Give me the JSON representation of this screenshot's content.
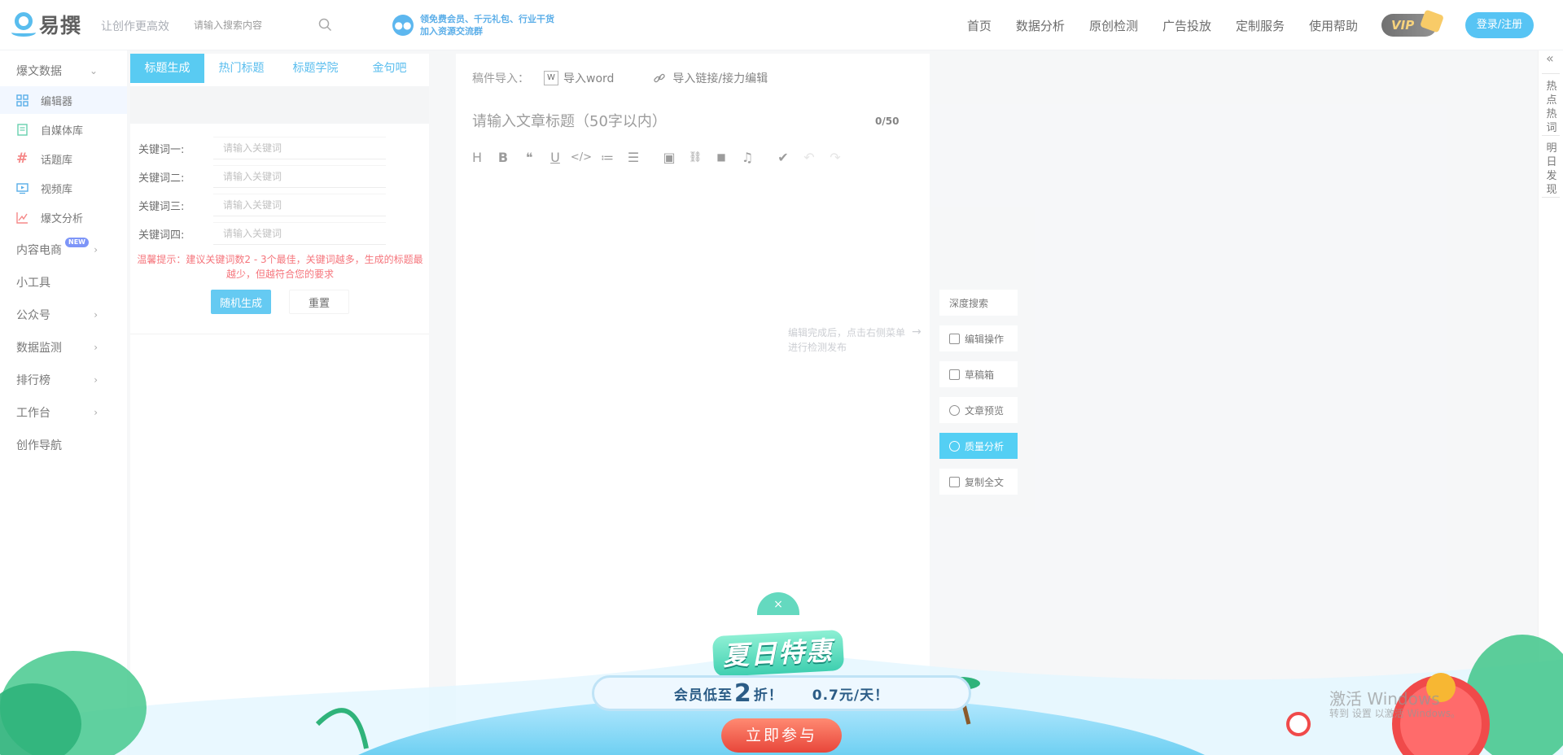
{
  "header": {
    "logo_text": "易撰",
    "slogan": "让创作更高效",
    "search_placeholder": "请输入搜索内容",
    "promo_line1": "领免费会员、千元礼包、行业干货",
    "promo_line2": "加入资源交流群",
    "nav": [
      "首页",
      "数据分析",
      "原创检测",
      "广告投放",
      "定制服务",
      "使用帮助"
    ],
    "vip": "VIP",
    "login": "登录/注册"
  },
  "sidebar": {
    "items": [
      {
        "label": "爆文数据",
        "chevron": "⌄"
      },
      {
        "label": "编辑器",
        "icon": "grid-icon"
      },
      {
        "label": "自媒体库",
        "icon": "document-icon"
      },
      {
        "label": "话题库",
        "icon": "hashtag-icon"
      },
      {
        "label": "视频库",
        "icon": "video-icon"
      },
      {
        "label": "爆文分析",
        "icon": "line-chart-icon"
      },
      {
        "label": "内容电商",
        "badge": "NEW",
        "chevron": "›"
      },
      {
        "label": "小工具"
      },
      {
        "label": "公众号",
        "chevron": "›"
      },
      {
        "label": "数据监测",
        "chevron": "›"
      },
      {
        "label": "排行榜",
        "chevron": "›"
      },
      {
        "label": "工作台",
        "chevron": "›"
      },
      {
        "label": "创作导航"
      }
    ]
  },
  "generator": {
    "tabs": [
      "标题生成",
      "热门标题",
      "标题学院",
      "金句吧"
    ],
    "keywords": [
      {
        "label": "关键词一:",
        "placeholder": "请输入关键词"
      },
      {
        "label": "关键词二:",
        "placeholder": "请输入关键词"
      },
      {
        "label": "关键词三:",
        "placeholder": "请输入关键词"
      },
      {
        "label": "关键词四:",
        "placeholder": "请输入关键词"
      }
    ],
    "warning": "温馨提示：建议关键词数2 - 3个最佳，关键词越多，生成的标题最越少，但越符合您的要求",
    "random_btn": "随机生成",
    "reset_btn": "重置"
  },
  "editor": {
    "import_label": "稿件导入：",
    "import_word": "导入word",
    "import_link": "导入链接/接力编辑",
    "title_placeholder": "请输入文章标题（50字以内）",
    "title_count": "0/50",
    "toolbar": {
      "heading": "H",
      "bold": "B",
      "quote": "❝",
      "underline": "U",
      "code": "</>",
      "ordered_list": "≔",
      "bullet_list": "☰",
      "image": "▣",
      "link": "⛓",
      "video": "■",
      "music": "♫",
      "clear": "✔",
      "undo": "↶",
      "redo": "↷"
    }
  },
  "actions": {
    "hint": "编辑完成后，点击右侧菜单进行检测发布",
    "items": [
      "深度搜索",
      "编辑操作",
      "草稿箱",
      "文章预览",
      "质量分析",
      "复制全文"
    ]
  },
  "edge": {
    "collapse": "«",
    "tab1": "热点热词",
    "tab2": "明日发现"
  },
  "promo": {
    "close": "×",
    "title": "夏日特惠",
    "bar_prefix": "会员低至",
    "bar_big": "2",
    "bar_suffix": "折！",
    "bar_price": "0.7元/天！",
    "cta": "立即参与",
    "watermark": "激活 Windows",
    "watermark_sub": "转到 设置 以激活 Windows。"
  },
  "colors": {
    "accent": "#1ab8ee",
    "warning": "#f2404a",
    "promo_cta": "#e8463a",
    "promo_teal": "#3fcfb0"
  }
}
